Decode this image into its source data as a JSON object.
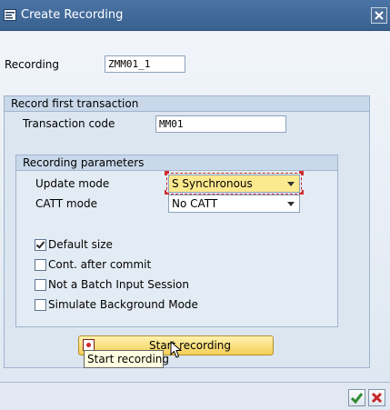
{
  "window": {
    "title": "Create Recording",
    "icons": {
      "app": "dialog-icon",
      "close": "close-icon"
    }
  },
  "header": {
    "recording_label": "Recording",
    "recording_value": "ZMM01_1"
  },
  "record_first": {
    "title": "Record first transaction",
    "tcode_label": "Transaction code",
    "tcode_value": "MM01"
  },
  "params": {
    "title": "Recording parameters",
    "update_mode_label": "Update mode",
    "update_mode_value": "S Synchronous",
    "catt_label": "CATT mode",
    "catt_value": "No CATT",
    "options": [
      {
        "label": "Default size",
        "checked": true
      },
      {
        "label": "Cont. after commit",
        "checked": false
      },
      {
        "label": "Not a Batch Input Session",
        "checked": false
      },
      {
        "label": "Simulate Background Mode",
        "checked": false
      }
    ]
  },
  "actions": {
    "start_label": "Start recording",
    "start_tooltip": "Start recording"
  },
  "colors": {
    "title_bar": "#3f6898",
    "button_yellow": "#f4cf55",
    "ok_green": "#2e8b2e",
    "cancel_red": "#c62828"
  }
}
